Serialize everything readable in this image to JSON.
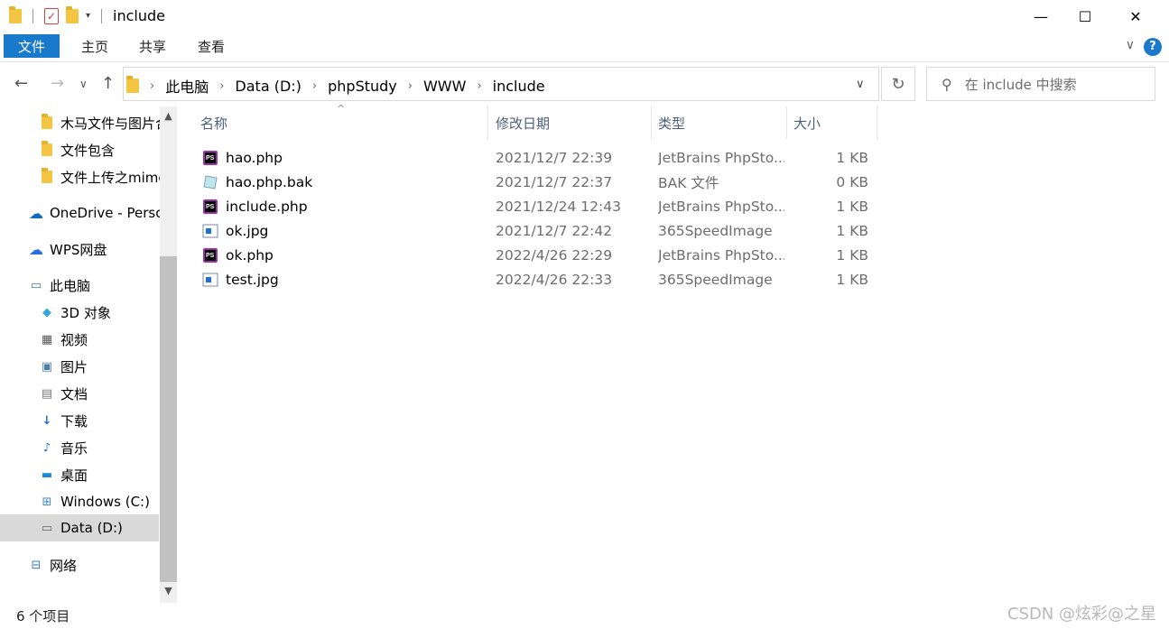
{
  "window": {
    "title": "include",
    "minimize": "—",
    "maximize": "☐",
    "close": "✕"
  },
  "ribbon": {
    "tabs": [
      {
        "label": "文件",
        "active": true
      },
      {
        "label": "主页"
      },
      {
        "label": "共享"
      },
      {
        "label": "查看"
      }
    ],
    "help": "?",
    "expand": "∨"
  },
  "nav": {
    "back": "←",
    "forward": "→",
    "recent": "∨",
    "up": "↑",
    "breadcrumbs": [
      "此电脑",
      "Data (D:)",
      "phpStudy",
      "WWW",
      "include"
    ],
    "address_dropdown": "∨",
    "refresh": "↻"
  },
  "search": {
    "placeholder": "在 include 中搜索"
  },
  "sidebar": {
    "items": [
      {
        "label": "木马文件与图片合",
        "icon": "folder-icon"
      },
      {
        "label": "文件包含",
        "icon": "folder-icon"
      },
      {
        "label": "文件上传之mime",
        "icon": "folder-icon"
      },
      {
        "label": "OneDrive - Perso",
        "icon": "onedrive-icon"
      },
      {
        "label": "WPS网盘",
        "icon": "wps-cloud-icon"
      },
      {
        "label": "此电脑",
        "icon": "computer-icon"
      },
      {
        "label": "3D 对象",
        "icon": "3d-objects-icon"
      },
      {
        "label": "视频",
        "icon": "video-icon"
      },
      {
        "label": "图片",
        "icon": "pictures-icon"
      },
      {
        "label": "文档",
        "icon": "documents-icon"
      },
      {
        "label": "下载",
        "icon": "download-icon"
      },
      {
        "label": "音乐",
        "icon": "music-icon"
      },
      {
        "label": "桌面",
        "icon": "desktop-icon"
      },
      {
        "label": "Windows (C:)",
        "icon": "drive-c-icon"
      },
      {
        "label": "Data (D:)",
        "icon": "drive-d-icon",
        "selected": true
      },
      {
        "label": "网络",
        "icon": "network-icon"
      }
    ]
  },
  "columns": {
    "name": "名称",
    "date": "修改日期",
    "type": "类型",
    "size": "大小",
    "sort_indicator": "^"
  },
  "files": [
    {
      "name": "hao.php",
      "date": "2021/12/7 22:39",
      "type": "JetBrains PhpSto...",
      "size": "1 KB",
      "icon": "phpstorm-file-icon"
    },
    {
      "name": "hao.php.bak",
      "date": "2021/12/7 22:37",
      "type": "BAK 文件",
      "size": "0 KB",
      "icon": "bak-file-icon"
    },
    {
      "name": "include.php",
      "date": "2021/12/24 12:43",
      "type": "JetBrains PhpSto...",
      "size": "1 KB",
      "icon": "phpstorm-file-icon"
    },
    {
      "name": "ok.jpg",
      "date": "2021/12/7 22:42",
      "type": "365SpeedImage",
      "size": "1 KB",
      "icon": "image-file-icon"
    },
    {
      "name": "ok.php",
      "date": "2022/4/26 22:29",
      "type": "JetBrains PhpSto...",
      "size": "1 KB",
      "icon": "phpstorm-file-icon"
    },
    {
      "name": "test.jpg",
      "date": "2022/4/26 22:33",
      "type": "365SpeedImage",
      "size": "1 KB",
      "icon": "image-file-icon"
    }
  ],
  "status": {
    "item_count": "6 个项目"
  },
  "watermark": "CSDN @炫彩@之星",
  "colors": {
    "accent": "#1979ca",
    "selected": "#d9d9d9",
    "header_text": "#4c607a",
    "meta_text": "#6d6d6d"
  }
}
